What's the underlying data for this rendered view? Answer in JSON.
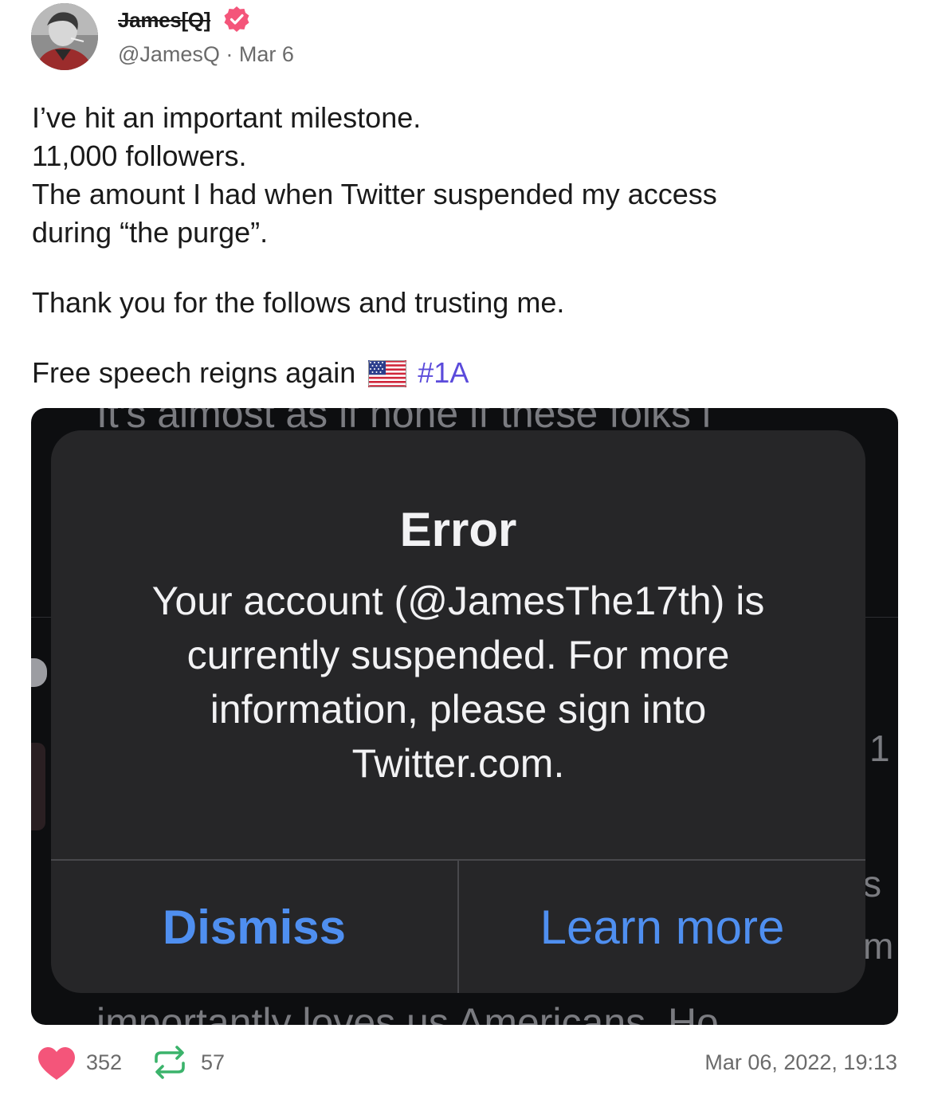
{
  "author": {
    "display_name": "James[Q]",
    "handle": "@JamesQ",
    "date": "Mar 6",
    "handle_line": "@JamesQ · Mar 6",
    "verified": true
  },
  "post": {
    "lines": [
      "I’ve hit an important milestone.",
      "11,000 followers.",
      "The amount I had when Twitter suspended my access",
      "during “the purge”."
    ],
    "thanks": "Thank you for the follows and trusting me.",
    "closing": "Free speech reigns again",
    "flag_icon": "us-flag-icon",
    "hashtag": "#1A"
  },
  "media": {
    "bg_top_text": "It's almost as if none if these folks l",
    "bg_bottom_text": "importantly loves us Americans. Ho",
    "bg_side": [
      "1",
      "s",
      "m"
    ],
    "dialog": {
      "title": "Error",
      "message": "Your account (@JamesThe17th) is currently suspended. For more information, please sign into Twitter.com.",
      "dismiss_label": "Dismiss",
      "learn_more_label": "Learn more"
    }
  },
  "footer": {
    "likes": "352",
    "reposts": "57",
    "timestamp": "Mar 06, 2022, 19:13"
  },
  "colors": {
    "hashtag": "#5b4bdb",
    "like": "#f4557a",
    "repost": "#3bb36b",
    "verified": "#f4557a",
    "dialog_button": "#4f8ff0"
  }
}
